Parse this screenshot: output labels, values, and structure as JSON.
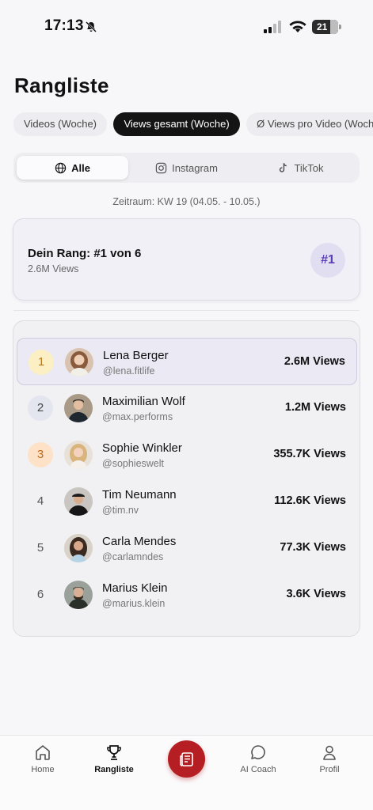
{
  "status_bar": {
    "time": "17:13",
    "battery": "21"
  },
  "page": {
    "title": "Rangliste"
  },
  "metric_tabs": [
    {
      "label": "Videos (Woche)",
      "active": false
    },
    {
      "label": "Views gesamt (Woche)",
      "active": true
    },
    {
      "label": "Ø Views pro Video (Woche)",
      "active": false
    }
  ],
  "platforms": [
    {
      "label": "Alle",
      "icon": "globe-icon",
      "active": true
    },
    {
      "label": "Instagram",
      "icon": "instagram-icon",
      "active": false
    },
    {
      "label": "TikTok",
      "icon": "tiktok-icon",
      "active": false
    }
  ],
  "period": "Zeitraum: KW 19 (04.05. - 10.05.)",
  "my_rank": {
    "title": "Dein Rang: #1 von 6",
    "subtitle": "2.6M Views",
    "badge": "#1"
  },
  "leaderboard": [
    {
      "rank": "1",
      "name": "Lena Berger",
      "handle": "@lena.fitlife",
      "views": "2.6M Views"
    },
    {
      "rank": "2",
      "name": "Maximilian Wolf",
      "handle": "@max.performs",
      "views": "1.2M Views"
    },
    {
      "rank": "3",
      "name": "Sophie Winkler",
      "handle": "@sophieswelt",
      "views": "355.7K Views"
    },
    {
      "rank": "4",
      "name": "Tim Neumann",
      "handle": "@tim.nv",
      "views": "112.6K Views"
    },
    {
      "rank": "5",
      "name": "Carla Mendes",
      "handle": "@carlamndes",
      "views": "77.3K Views"
    },
    {
      "rank": "6",
      "name": "Marius Klein",
      "handle": "@marius.klein",
      "views": "3.6K Views"
    }
  ],
  "bottom_nav": {
    "home": "Home",
    "rangliste": "Rangliste",
    "ai_coach": "AI Coach",
    "profil": "Profil"
  },
  "colors": {
    "accent": "#b51e22",
    "rank_badge": "#5b3db8"
  }
}
